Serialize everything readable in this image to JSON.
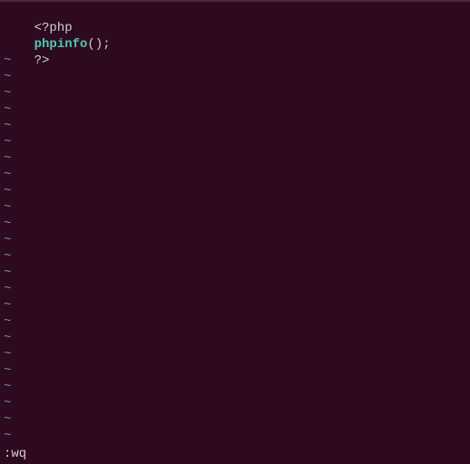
{
  "code": {
    "line1_open": "<?php",
    "line2_func": "phpinfo",
    "line2_parens": "();",
    "line3_close": "?>"
  },
  "tilde": "~",
  "command": ":wq",
  "tilde_count": 25
}
